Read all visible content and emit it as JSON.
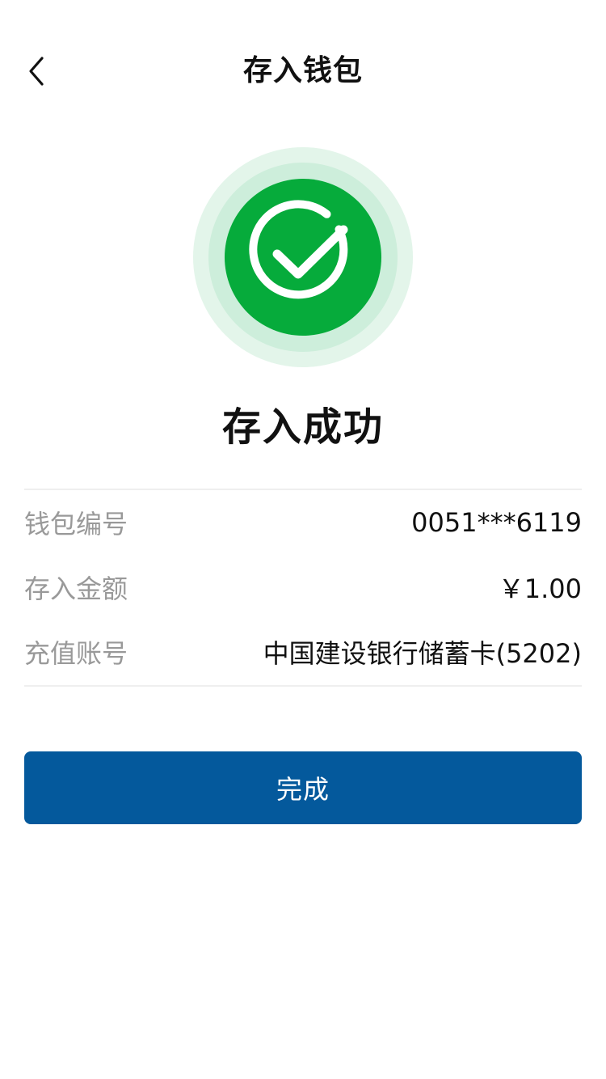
{
  "header": {
    "title": "存入钱包",
    "back_icon": "chevron-left-icon"
  },
  "status": {
    "icon": "check-circle-icon",
    "title": "存入成功",
    "colors": {
      "icon_fill": "#06ab3b",
      "ring_outer": "#e3f5ea",
      "ring_inner": "#cdeedb",
      "check": "#ffffff"
    }
  },
  "details": {
    "rows": [
      {
        "label": "钱包编号",
        "value": "0051***6119"
      },
      {
        "label": "存入金额",
        "value": "￥1.00"
      },
      {
        "label": "充值账号",
        "value": "中国建设银行储蓄卡(5202)"
      }
    ]
  },
  "actions": {
    "done_label": "完成",
    "done_color": "#04599c"
  }
}
